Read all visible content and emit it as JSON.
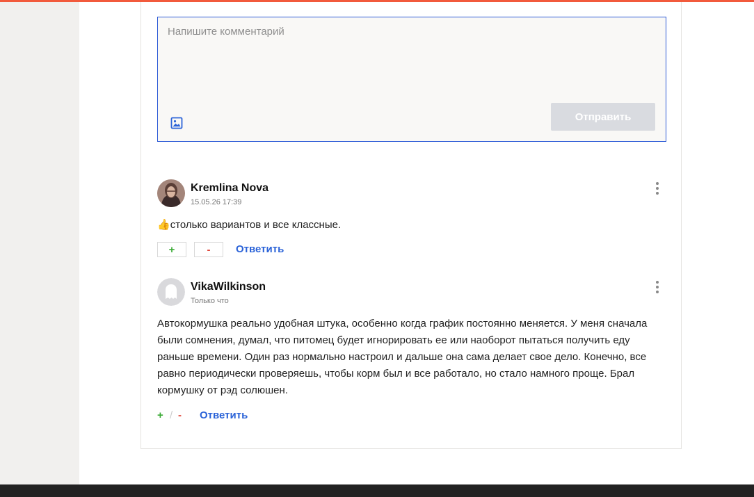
{
  "composer": {
    "placeholder": "Напишите комментарий",
    "send_label": "Отправить",
    "image_icon": "image-icon"
  },
  "comments": [
    {
      "author": "Kremlina Nova",
      "time": "15.05.26 17:39",
      "emoji": "👍",
      "text": "столько вариантов и все классные.",
      "plus": "+",
      "minus": "-",
      "reply": "Ответить",
      "avatar_icon": "user-photo"
    },
    {
      "author": "VikaWilkinson",
      "time": "Только что",
      "text": "Автокормушка реально удобная штука, особенно когда график постоянно меняется. У меня сначала были сомнения, думал, что питомец будет игнорировать ее или наоборот пытаться получить еду раньше времени. Один раз нормально настроил и дальше она сама делает свое дело. Конечно, все равно периодически проверяешь, чтобы корм был и все работало, но стало намного проще. Брал кормушку от рэд солюшен.",
      "plus": "+",
      "separator": "/",
      "minus": "-",
      "reply": "Ответить",
      "avatar_icon": "ghost-avatar"
    }
  ],
  "colors": {
    "accent": "#f25a3c",
    "link": "#2b63d8",
    "plus": "#3aaa35",
    "minus": "#e0453a",
    "composer_border": "#2d5bd6",
    "send_disabled": "#d9dbe0"
  }
}
